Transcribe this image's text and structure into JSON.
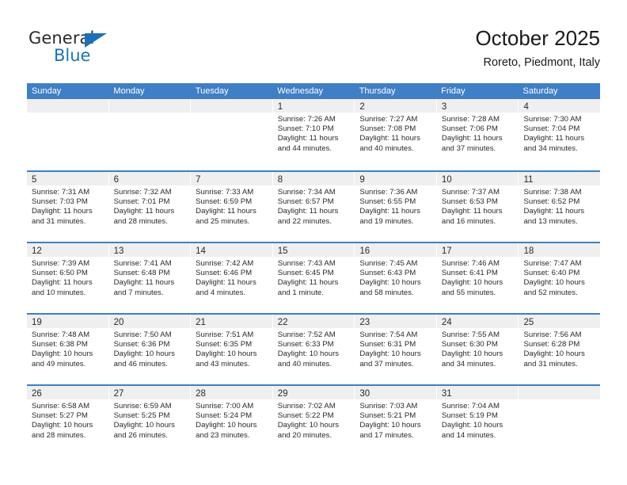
{
  "brand": {
    "name_top": "General",
    "name_bottom": "Blue",
    "triangle_color": "#1d6fb8",
    "text_color": "#2b2b2b",
    "blue_color": "#1d72bb"
  },
  "header": {
    "title": "October 2025",
    "subtitle": "Roreto, Piedmont, Italy"
  },
  "theme": {
    "header_blue": "#3e7fc6",
    "daynum_bg": "#efefef",
    "text": "#2a2a2a",
    "page_bg": "#ffffff"
  },
  "weekdays": [
    "Sunday",
    "Monday",
    "Tuesday",
    "Wednesday",
    "Thursday",
    "Friday",
    "Saturday"
  ],
  "weeks": [
    [
      {
        "day": "",
        "empty": true
      },
      {
        "day": "",
        "empty": true
      },
      {
        "day": "",
        "empty": true
      },
      {
        "day": "1",
        "sunrise": "Sunrise: 7:26 AM",
        "sunset": "Sunset: 7:10 PM",
        "daylight1": "Daylight: 11 hours",
        "daylight2": "and 44 minutes."
      },
      {
        "day": "2",
        "sunrise": "Sunrise: 7:27 AM",
        "sunset": "Sunset: 7:08 PM",
        "daylight1": "Daylight: 11 hours",
        "daylight2": "and 40 minutes."
      },
      {
        "day": "3",
        "sunrise": "Sunrise: 7:28 AM",
        "sunset": "Sunset: 7:06 PM",
        "daylight1": "Daylight: 11 hours",
        "daylight2": "and 37 minutes."
      },
      {
        "day": "4",
        "sunrise": "Sunrise: 7:30 AM",
        "sunset": "Sunset: 7:04 PM",
        "daylight1": "Daylight: 11 hours",
        "daylight2": "and 34 minutes."
      }
    ],
    [
      {
        "day": "5",
        "sunrise": "Sunrise: 7:31 AM",
        "sunset": "Sunset: 7:03 PM",
        "daylight1": "Daylight: 11 hours",
        "daylight2": "and 31 minutes."
      },
      {
        "day": "6",
        "sunrise": "Sunrise: 7:32 AM",
        "sunset": "Sunset: 7:01 PM",
        "daylight1": "Daylight: 11 hours",
        "daylight2": "and 28 minutes."
      },
      {
        "day": "7",
        "sunrise": "Sunrise: 7:33 AM",
        "sunset": "Sunset: 6:59 PM",
        "daylight1": "Daylight: 11 hours",
        "daylight2": "and 25 minutes."
      },
      {
        "day": "8",
        "sunrise": "Sunrise: 7:34 AM",
        "sunset": "Sunset: 6:57 PM",
        "daylight1": "Daylight: 11 hours",
        "daylight2": "and 22 minutes."
      },
      {
        "day": "9",
        "sunrise": "Sunrise: 7:36 AM",
        "sunset": "Sunset: 6:55 PM",
        "daylight1": "Daylight: 11 hours",
        "daylight2": "and 19 minutes."
      },
      {
        "day": "10",
        "sunrise": "Sunrise: 7:37 AM",
        "sunset": "Sunset: 6:53 PM",
        "daylight1": "Daylight: 11 hours",
        "daylight2": "and 16 minutes."
      },
      {
        "day": "11",
        "sunrise": "Sunrise: 7:38 AM",
        "sunset": "Sunset: 6:52 PM",
        "daylight1": "Daylight: 11 hours",
        "daylight2": "and 13 minutes."
      }
    ],
    [
      {
        "day": "12",
        "sunrise": "Sunrise: 7:39 AM",
        "sunset": "Sunset: 6:50 PM",
        "daylight1": "Daylight: 11 hours",
        "daylight2": "and 10 minutes."
      },
      {
        "day": "13",
        "sunrise": "Sunrise: 7:41 AM",
        "sunset": "Sunset: 6:48 PM",
        "daylight1": "Daylight: 11 hours",
        "daylight2": "and 7 minutes."
      },
      {
        "day": "14",
        "sunrise": "Sunrise: 7:42 AM",
        "sunset": "Sunset: 6:46 PM",
        "daylight1": "Daylight: 11 hours",
        "daylight2": "and 4 minutes."
      },
      {
        "day": "15",
        "sunrise": "Sunrise: 7:43 AM",
        "sunset": "Sunset: 6:45 PM",
        "daylight1": "Daylight: 11 hours",
        "daylight2": "and 1 minute."
      },
      {
        "day": "16",
        "sunrise": "Sunrise: 7:45 AM",
        "sunset": "Sunset: 6:43 PM",
        "daylight1": "Daylight: 10 hours",
        "daylight2": "and 58 minutes."
      },
      {
        "day": "17",
        "sunrise": "Sunrise: 7:46 AM",
        "sunset": "Sunset: 6:41 PM",
        "daylight1": "Daylight: 10 hours",
        "daylight2": "and 55 minutes."
      },
      {
        "day": "18",
        "sunrise": "Sunrise: 7:47 AM",
        "sunset": "Sunset: 6:40 PM",
        "daylight1": "Daylight: 10 hours",
        "daylight2": "and 52 minutes."
      }
    ],
    [
      {
        "day": "19",
        "sunrise": "Sunrise: 7:48 AM",
        "sunset": "Sunset: 6:38 PM",
        "daylight1": "Daylight: 10 hours",
        "daylight2": "and 49 minutes."
      },
      {
        "day": "20",
        "sunrise": "Sunrise: 7:50 AM",
        "sunset": "Sunset: 6:36 PM",
        "daylight1": "Daylight: 10 hours",
        "daylight2": "and 46 minutes."
      },
      {
        "day": "21",
        "sunrise": "Sunrise: 7:51 AM",
        "sunset": "Sunset: 6:35 PM",
        "daylight1": "Daylight: 10 hours",
        "daylight2": "and 43 minutes."
      },
      {
        "day": "22",
        "sunrise": "Sunrise: 7:52 AM",
        "sunset": "Sunset: 6:33 PM",
        "daylight1": "Daylight: 10 hours",
        "daylight2": "and 40 minutes."
      },
      {
        "day": "23",
        "sunrise": "Sunrise: 7:54 AM",
        "sunset": "Sunset: 6:31 PM",
        "daylight1": "Daylight: 10 hours",
        "daylight2": "and 37 minutes."
      },
      {
        "day": "24",
        "sunrise": "Sunrise: 7:55 AM",
        "sunset": "Sunset: 6:30 PM",
        "daylight1": "Daylight: 10 hours",
        "daylight2": "and 34 minutes."
      },
      {
        "day": "25",
        "sunrise": "Sunrise: 7:56 AM",
        "sunset": "Sunset: 6:28 PM",
        "daylight1": "Daylight: 10 hours",
        "daylight2": "and 31 minutes."
      }
    ],
    [
      {
        "day": "26",
        "sunrise": "Sunrise: 6:58 AM",
        "sunset": "Sunset: 5:27 PM",
        "daylight1": "Daylight: 10 hours",
        "daylight2": "and 28 minutes."
      },
      {
        "day": "27",
        "sunrise": "Sunrise: 6:59 AM",
        "sunset": "Sunset: 5:25 PM",
        "daylight1": "Daylight: 10 hours",
        "daylight2": "and 26 minutes."
      },
      {
        "day": "28",
        "sunrise": "Sunrise: 7:00 AM",
        "sunset": "Sunset: 5:24 PM",
        "daylight1": "Daylight: 10 hours",
        "daylight2": "and 23 minutes."
      },
      {
        "day": "29",
        "sunrise": "Sunrise: 7:02 AM",
        "sunset": "Sunset: 5:22 PM",
        "daylight1": "Daylight: 10 hours",
        "daylight2": "and 20 minutes."
      },
      {
        "day": "30",
        "sunrise": "Sunrise: 7:03 AM",
        "sunset": "Sunset: 5:21 PM",
        "daylight1": "Daylight: 10 hours",
        "daylight2": "and 17 minutes."
      },
      {
        "day": "31",
        "sunrise": "Sunrise: 7:04 AM",
        "sunset": "Sunset: 5:19 PM",
        "daylight1": "Daylight: 10 hours",
        "daylight2": "and 14 minutes."
      },
      {
        "day": "",
        "empty": true
      }
    ]
  ]
}
